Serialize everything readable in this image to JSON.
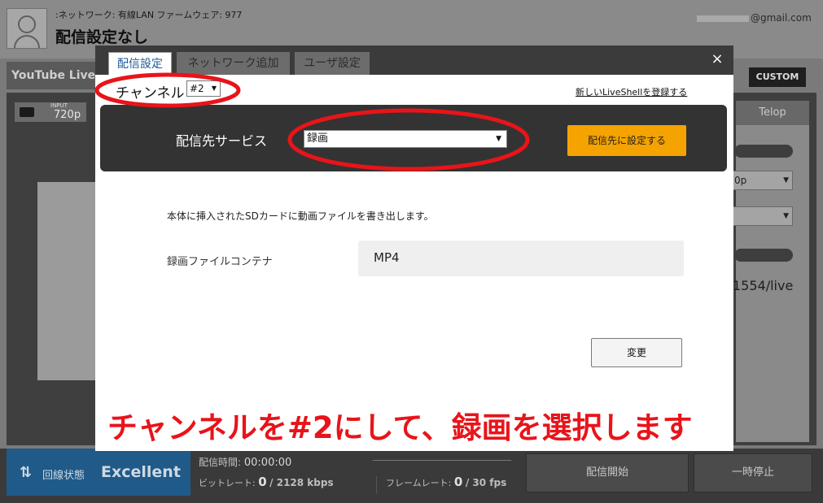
{
  "header": {
    "network_info": ":ネットワーク: 有線LAN ファームウェア: 977",
    "title": "配信設定なし",
    "email_suffix": "@gmail.com"
  },
  "background": {
    "platform_label": "YouTube Live",
    "custom_button": "CUSTOM",
    "input_label": "INPUT",
    "input_resolution": "720p",
    "telop_tab": "Telop",
    "resolution_select_partial": "0p",
    "url_partial": "1554/live"
  },
  "bottom_bar": {
    "status_label": "回線状態",
    "status_value": "Excellent",
    "time_label": "配信時間:",
    "time_value": "00:00:00",
    "bitrate_label": "ビットレート:",
    "bitrate_value": "0",
    "bitrate_max": "/ 2128 kbps",
    "framerate_label": "フレームレート:",
    "framerate_value": "0",
    "framerate_max": "/ 30 fps",
    "start_button": "配信開始",
    "pause_button": "一時停止"
  },
  "modal": {
    "tabs": [
      {
        "label": "配信設定",
        "active": true
      },
      {
        "label": "ネットワーク追加",
        "active": false
      },
      {
        "label": "ユーザ設定",
        "active": false
      }
    ],
    "close_icon": "×",
    "channel_label": "チャンネル",
    "channel_value": "#2",
    "register_link": "新しいLiveShellを登録する",
    "service_label": "配信先サービス",
    "service_value": "録画",
    "set_button": "配信先に設定する",
    "description": "本体に挿入されたSDカードに動画ファイルを書き出します。",
    "container_label": "録画ファイルコンテナ",
    "container_value": "MP4",
    "change_button": "変更"
  },
  "annotation": {
    "caption": "チャンネルを#2にして、録画を選択します",
    "color": "#e8141a"
  },
  "colors": {
    "accent_orange": "#f5a300",
    "status_blue": "#1f5a89",
    "tab_active_text": "#1e5a9a"
  }
}
